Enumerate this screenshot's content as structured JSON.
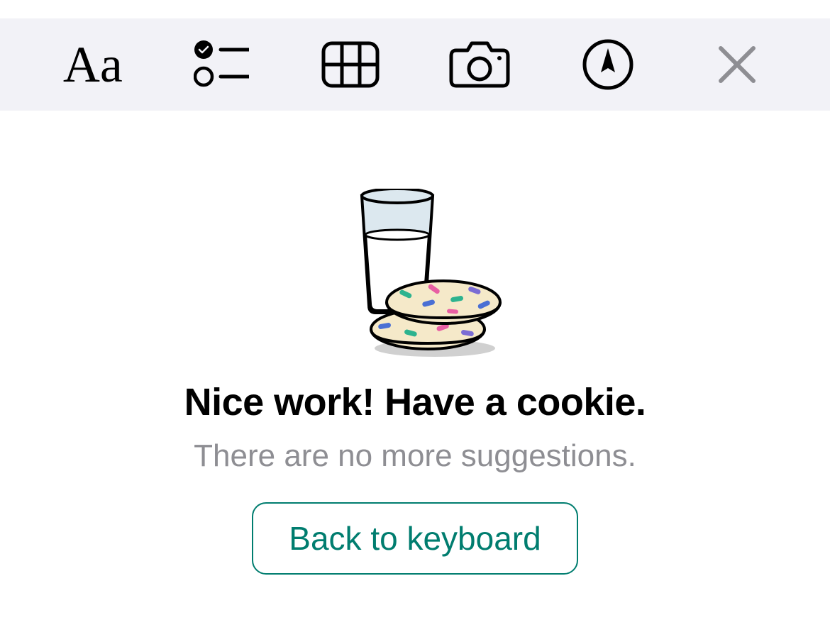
{
  "toolbar": {
    "text_format_label": "Aa"
  },
  "content": {
    "heading": "Nice work! Have a cookie.",
    "subtext": "There are no more suggestions.",
    "button_label": "Back to keyboard"
  }
}
